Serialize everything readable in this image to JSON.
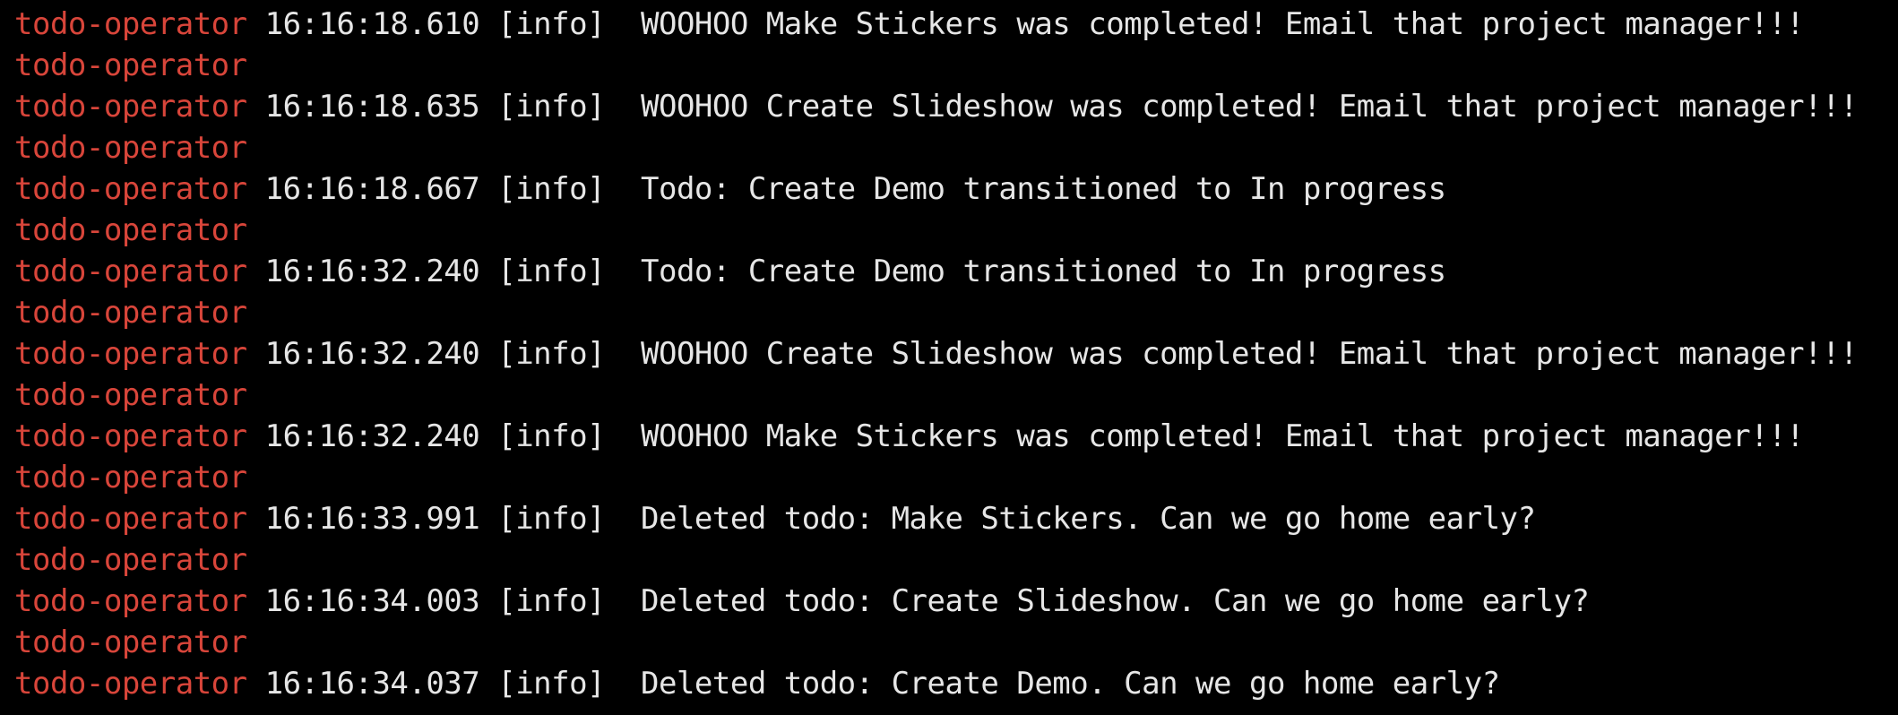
{
  "terminal": {
    "prefix": "todo-operator",
    "prefix_color": "#d8453a",
    "text_color": "#e6e6e6",
    "background": "#000000",
    "lines": [
      {
        "timestamp": "16:16:18.610",
        "level": "[info]",
        "message": "WOOHOO Make Stickers was completed! Email that project manager!!!"
      },
      {
        "timestamp": "16:16:18.635",
        "level": "[info]",
        "message": "WOOHOO Create Slideshow was completed! Email that project manager!!!"
      },
      {
        "timestamp": "16:16:18.667",
        "level": "[info]",
        "message": "Todo: Create Demo transitioned to In progress"
      },
      {
        "timestamp": "16:16:32.240",
        "level": "[info]",
        "message": "Todo: Create Demo transitioned to In progress"
      },
      {
        "timestamp": "16:16:32.240",
        "level": "[info]",
        "message": "WOOHOO Create Slideshow was completed! Email that project manager!!!"
      },
      {
        "timestamp": "16:16:32.240",
        "level": "[info]",
        "message": "WOOHOO Make Stickers was completed! Email that project manager!!!"
      },
      {
        "timestamp": "16:16:33.991",
        "level": "[info]",
        "message": "Deleted todo: Make Stickers. Can we go home early?"
      },
      {
        "timestamp": "16:16:34.003",
        "level": "[info]",
        "message": "Deleted todo: Create Slideshow. Can we go home early?"
      },
      {
        "timestamp": "16:16:34.037",
        "level": "[info]",
        "message": "Deleted todo: Create Demo. Can we go home early?"
      }
    ]
  }
}
